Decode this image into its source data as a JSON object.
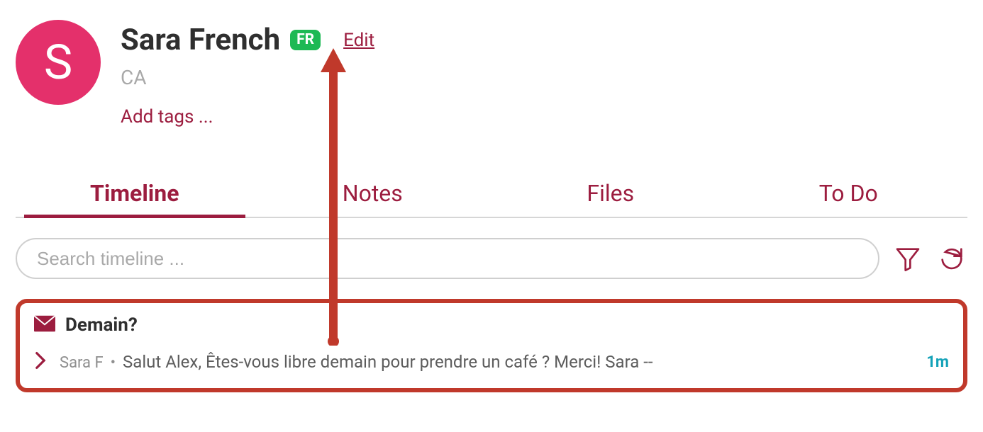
{
  "contact": {
    "avatar_initial": "S",
    "name": "Sara French",
    "lang_badge": "FR",
    "edit_label": "Edit",
    "location": "CA",
    "add_tags_label": "Add tags ..."
  },
  "tabs": {
    "timeline": "Timeline",
    "notes": "Notes",
    "files": "Files",
    "todo": "To Do",
    "active": "timeline"
  },
  "search": {
    "placeholder": "Search timeline ..."
  },
  "timeline_item": {
    "subject": "Demain?",
    "sender": "Sara F",
    "preview": "Salut Alex, Êtes-vous libre demain pour prendre un café ? Merci! Sara --",
    "timestamp": "1m"
  },
  "colors": {
    "accent": "#9c1d3f",
    "avatar_bg": "#e4306b",
    "badge_bg": "#1db954",
    "highlight_border": "#c0392b",
    "timestamp": "#14a2b8"
  }
}
